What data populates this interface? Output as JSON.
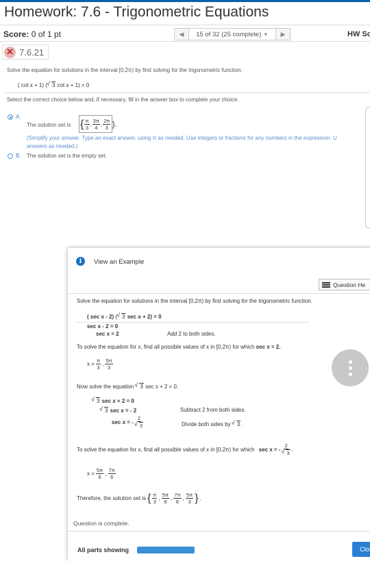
{
  "header": {
    "title": "Homework: 7.6 - Trigonometric Equations",
    "score_label": "Score:",
    "score_value": " 0 of 1 pt",
    "pager_text": "15 of 32 (25 complete)",
    "pager_caret": "▼",
    "pager_prev": "◀",
    "pager_next": "▶",
    "hw_label": "HW Sco"
  },
  "question": {
    "status_icon": "x-icon",
    "number": "7.6.21",
    "prompt": "Solve the equation for solutions in the interval [0,2π) by first solving for the trigonometric function.",
    "equation_p1": "( cot x + 1)",
    "equation_sqrt": "3",
    "equation_p2": " cot x + 1)  = 0",
    "instruction": "Select the correct choice below and, if necessary, fill in the answer box to complete your choice.",
    "option_a_letter": "A.",
    "option_a_text": "The solution set is",
    "answer": {
      "open": "{",
      "f1_n": "π",
      "f1_d": "3",
      "f2_n": "3π",
      "f2_d": "4",
      "f3_n": "2π",
      "f3_d": "3",
      "close": "}."
    },
    "hint_line1": "(Simplify your answer. Type an exact answer, using π as needed. Use integers or fractions for any numbers in the expression. U",
    "hint_line2": "answers as needed.)",
    "option_b_letter": "B.",
    "option_b_text": "The solution set is the empty set."
  },
  "example": {
    "title": "View an Example",
    "help_button": "Question He",
    "prompt": "Solve the equation for solutions in the interval [0,2π) by first solving for the trigonometric function.",
    "eq_p1": "( sec x - 2)",
    "eq_sqrt": "3",
    "eq_p2": " sec x + 2)  = 0",
    "s1": "sec x - 2 = 0",
    "s2": "sec x = 2",
    "s2_note": "Add 2 to both sides.",
    "line_a": "To solve the equation for x, find all possible values of x in [0,2π) for which",
    "line_a_bold": "sec x = 2.",
    "x1_label": "x =",
    "x1_f1_n": "π",
    "x1_f1_d": "3",
    "x1_f2_n": "5π",
    "x1_f2_d": "3",
    "line_b_pre": "Now solve the equation",
    "line_b_sqrt": "3",
    "line_b_post": " sec x + 2 = 0.",
    "t1_sqrt": "3",
    "t1": " sec x + 2 = 0",
    "t2_sqrt": "3",
    "t2": " sec x = - 2",
    "t2_note": "Subtract 2 from both sides.",
    "t3_label": "sec x = -",
    "t3_n": "2",
    "t3_d_sqrt": "3",
    "t3_note_pre": "Divide both sides by",
    "t3_note_sqrt": "3",
    "t3_note_post": ".",
    "line_c": "To solve the equation for x, find all possible values of x in [0,2π) for which",
    "line_c_bold": "sec x = -",
    "line_c_n": "2",
    "line_c_d_sqrt": "3",
    "x2_label": "x =",
    "x2_f1_n": "5π",
    "x2_f1_d": "6",
    "x2_f2_n": "7π",
    "x2_f2_d": "6",
    "therefore": "Therefore, the solution set is",
    "set": {
      "a_n": "π",
      "a_d": "3",
      "b_n": "5π",
      "b_d": "6",
      "c_n": "7π",
      "c_d": "6",
      "d_n": "5π",
      "d_d": "3"
    },
    "complete": "Question is complete.",
    "parts_label": "All parts showing",
    "progress_fraction": 1.0,
    "close_label": "Clos"
  },
  "colors": {
    "accent": "#2a7fd4",
    "error": "#c62828",
    "hint": "#5b8fd0"
  }
}
